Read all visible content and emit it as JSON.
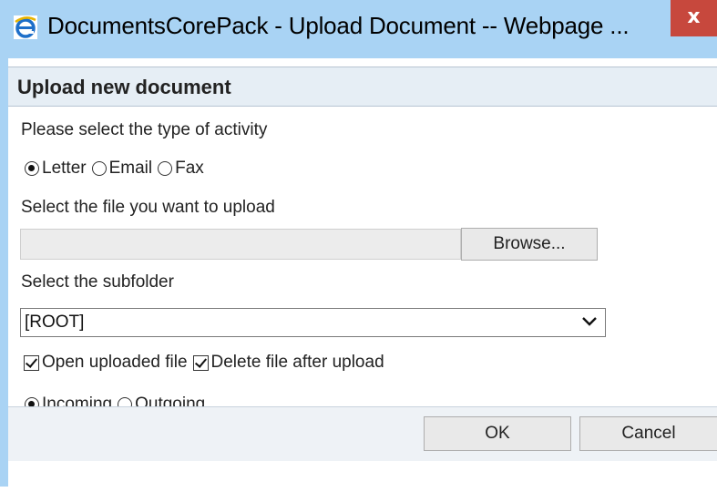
{
  "window": {
    "title": "DocumentsCorePack - Upload Document -- Webpage ...",
    "close_label": "x",
    "icon": "internet-explorer-icon"
  },
  "dialog": {
    "header": "Upload new document",
    "activity_label": "Please select the type of activity",
    "activity_options": [
      {
        "label": "Letter",
        "checked": true
      },
      {
        "label": "Email",
        "checked": false
      },
      {
        "label": "Fax",
        "checked": false
      }
    ],
    "file_label": "Select the file you want to upload",
    "file_value": "",
    "browse_label": "Browse...",
    "subfolder_label": "Select the subfolder",
    "subfolder_value": "[ROOT]",
    "open_uploaded_label": "Open uploaded file",
    "open_uploaded_checked": true,
    "delete_after_label": "Delete file after upload",
    "delete_after_checked": true,
    "direction_options": [
      {
        "label": "Incoming",
        "checked": true
      },
      {
        "label": "Outgoing",
        "checked": false
      }
    ],
    "ok_label": "OK",
    "cancel_label": "Cancel"
  },
  "colors": {
    "titlebar": "#a9d3f4",
    "close_button": "#c7483d",
    "header_bar": "#e6eef5"
  }
}
